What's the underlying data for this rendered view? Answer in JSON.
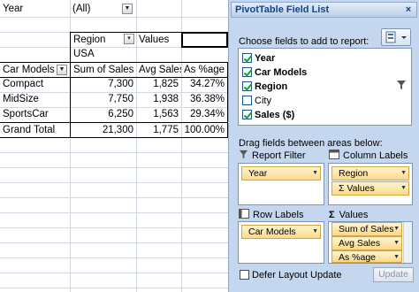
{
  "sheet": {
    "filter_label": "Year",
    "filter_value": "(All)",
    "region_header": "Region",
    "values_header": "Values",
    "region_value": "USA",
    "columns": [
      "Car Models",
      "Sum of Sales",
      "Avg Sales",
      "As %age"
    ],
    "rows": [
      {
        "model": "Compact",
        "sum": "7,300",
        "avg": "1,825",
        "pct": "34.27%"
      },
      {
        "model": "MidSize",
        "sum": "7,750",
        "avg": "1,938",
        "pct": "36.38%"
      },
      {
        "model": "SportsCar",
        "sum": "6,250",
        "avg": "1,563",
        "pct": "29.34%"
      }
    ],
    "grand_total": {
      "label": "Grand Total",
      "sum": "21,300",
      "avg": "1,775",
      "pct": "100.00%"
    }
  },
  "pane": {
    "title": "PivotTable Field List",
    "close": "×",
    "choose_label": "Choose fields to add to report:",
    "fields": [
      {
        "label": "Year",
        "checked": true
      },
      {
        "label": "Car Models",
        "checked": true
      },
      {
        "label": "Region",
        "checked": true
      },
      {
        "label": "City",
        "checked": false
      },
      {
        "label": "Sales ($)",
        "checked": true
      }
    ],
    "drag_label": "Drag fields between areas below:",
    "report_filter_label": "Report Filter",
    "column_labels_label": "Column Labels",
    "row_labels_label": "Row Labels",
    "values_label": "Values",
    "sigma": "Σ",
    "report_filter_items": [
      "Year"
    ],
    "column_label_items": [
      "Region",
      "Values"
    ],
    "row_label_items": [
      "Car Models"
    ],
    "value_items": [
      "Sum of Sales",
      "Avg Sales",
      "As %age"
    ],
    "defer_label": "Defer Layout Update",
    "update_label": "Update"
  },
  "colors": {
    "pane_bg": "#c5d7ee",
    "chip_bg": "#fbd98a",
    "title_text": "#15428b"
  }
}
